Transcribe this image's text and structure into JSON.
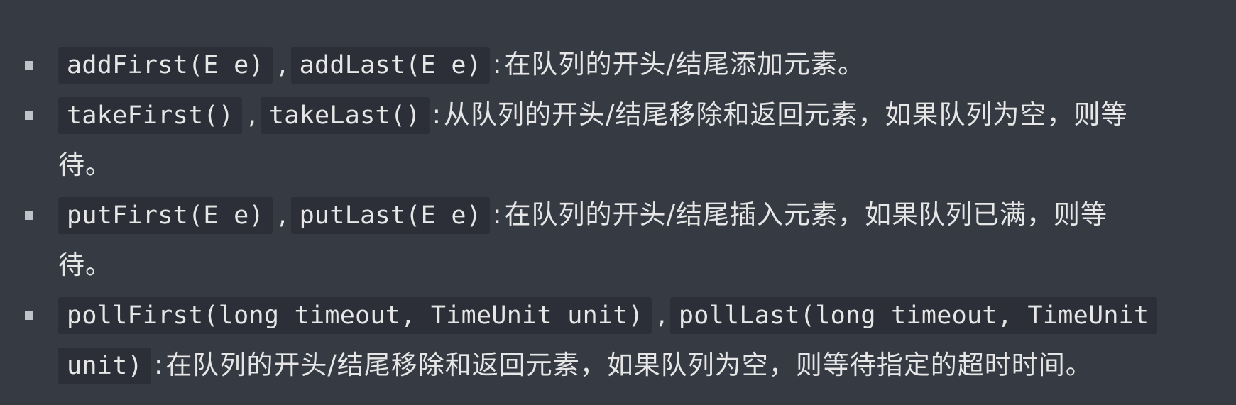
{
  "items": [
    {
      "code1": "addFirst(E e)",
      "sep": ",",
      "code2": "addLast(E e)",
      "colon": ":",
      "desc": "在队列的开头/结尾添加元素。"
    },
    {
      "code1": "takeFirst()",
      "sep": ",",
      "code2": "takeLast()",
      "colon": ":",
      "desc_line1": "从队列的开头/结尾移除和返回元素，如果队列为空，则等",
      "desc_line2": "待。"
    },
    {
      "code1": "putFirst(E e)",
      "sep": ",",
      "code2": "putLast(E e)",
      "colon": ":",
      "desc_line1": "在队列的开头/结尾插入元素，如果队列已满，则等",
      "desc_line2": "待。"
    },
    {
      "code1": "pollFirst(long timeout, TimeUnit unit)",
      "sep": ",",
      "code2_line1": "pollLast(long timeout, TimeUnit",
      "code2_line2": "unit)",
      "colon": ":",
      "desc": "在队列的开头/结尾移除和返回元素，如果队列为空，则等待指定的超时时间。"
    }
  ]
}
